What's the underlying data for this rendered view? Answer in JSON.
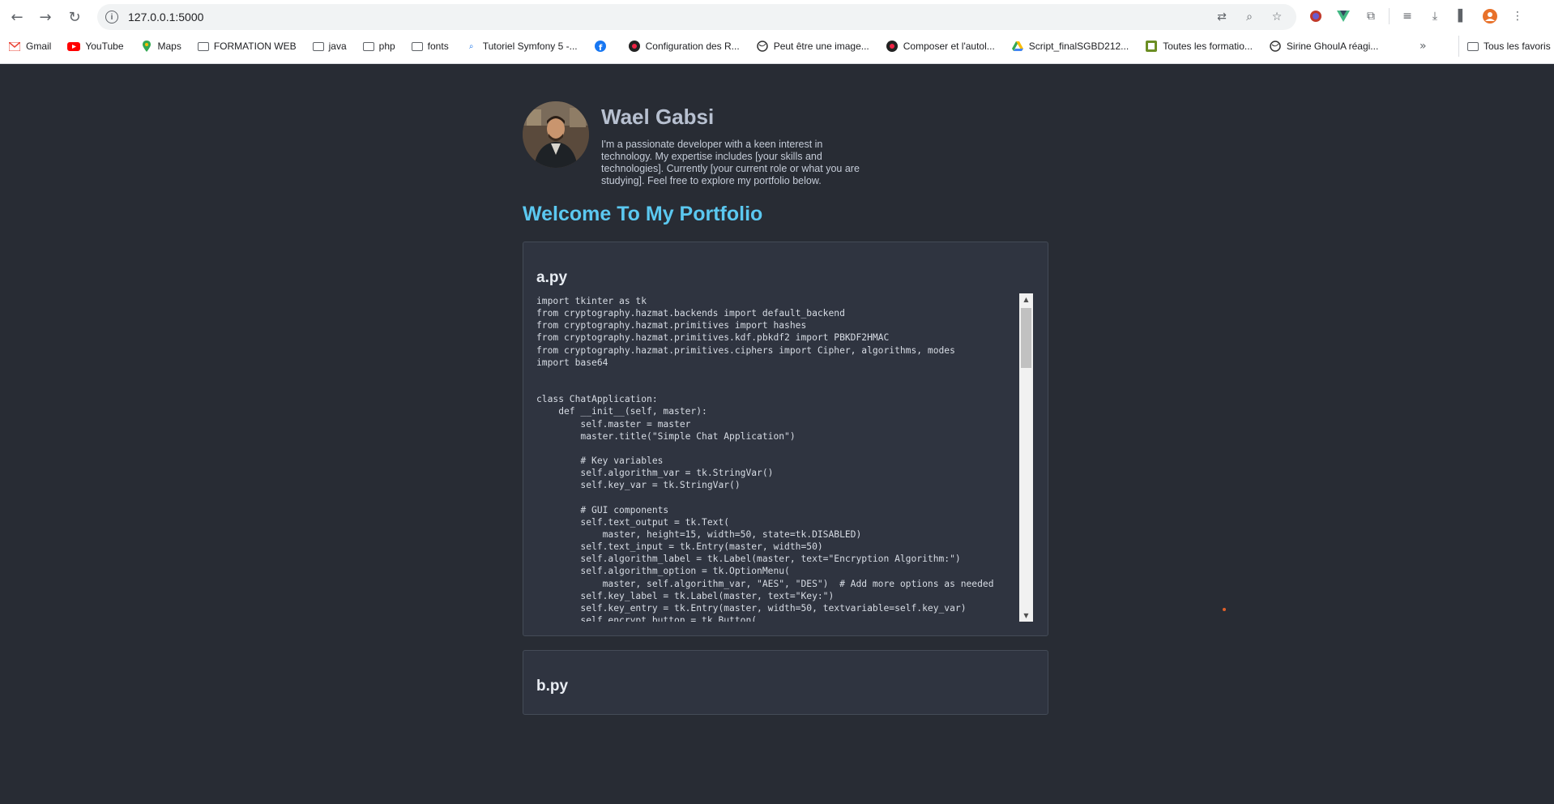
{
  "browser": {
    "url": "127.0.0.1:5000",
    "bookmarks": [
      {
        "label": "Gmail",
        "icon": "gmail-icon"
      },
      {
        "label": "YouTube",
        "icon": "youtube-icon"
      },
      {
        "label": "Maps",
        "icon": "maps-icon"
      },
      {
        "label": "FORMATION WEB",
        "icon": "folder-icon"
      },
      {
        "label": "java",
        "icon": "folder-icon"
      },
      {
        "label": "php",
        "icon": "folder-icon"
      },
      {
        "label": "fonts",
        "icon": "folder-icon"
      },
      {
        "label": "Tutoriel Symfony 5 -...",
        "icon": "search-icon"
      },
      {
        "label": "",
        "icon": "facebook-icon"
      },
      {
        "label": "Configuration des R...",
        "icon": "site-icon"
      },
      {
        "label": "Peut être une image...",
        "icon": "globe-icon"
      },
      {
        "label": "Composer et l'autol...",
        "icon": "site-icon"
      },
      {
        "label": "Script_finalSGBD212...",
        "icon": "drive-icon"
      },
      {
        "label": "Toutes les formatio...",
        "icon": "site-icon"
      },
      {
        "label": "Sirine GhoulA réagi...",
        "icon": "globe-icon"
      }
    ],
    "all_bookmarks": "Tous les favoris"
  },
  "profile": {
    "name": "Wael Gabsi",
    "bio": "I'm a passionate developer with a keen interest in technology. My expertise includes [your skills and technologies]. Currently [your current role or what you are studying]. Feel free to explore my portfolio below."
  },
  "welcome": "Welcome To My Portfolio",
  "files": [
    {
      "name": "a.py",
      "code": "import tkinter as tk\nfrom cryptography.hazmat.backends import default_backend\nfrom cryptography.hazmat.primitives import hashes\nfrom cryptography.hazmat.primitives.kdf.pbkdf2 import PBKDF2HMAC\nfrom cryptography.hazmat.primitives.ciphers import Cipher, algorithms, modes\nimport base64\n\n\nclass ChatApplication:\n    def __init__(self, master):\n        self.master = master\n        master.title(\"Simple Chat Application\")\n\n        # Key variables\n        self.algorithm_var = tk.StringVar()\n        self.key_var = tk.StringVar()\n\n        # GUI components\n        self.text_output = tk.Text(\n            master, height=15, width=50, state=tk.DISABLED)\n        self.text_input = tk.Entry(master, width=50)\n        self.algorithm_label = tk.Label(master, text=\"Encryption Algorithm:\")\n        self.algorithm_option = tk.OptionMenu(\n            master, self.algorithm_var, \"AES\", \"DES\")  # Add more options as needed\n        self.key_label = tk.Label(master, text=\"Key:\")\n        self.key_entry = tk.Entry(master, width=50, textvariable=self.key_var)\n        self.encrypt_button = tk.Button("
    },
    {
      "name": "b.py"
    }
  ]
}
